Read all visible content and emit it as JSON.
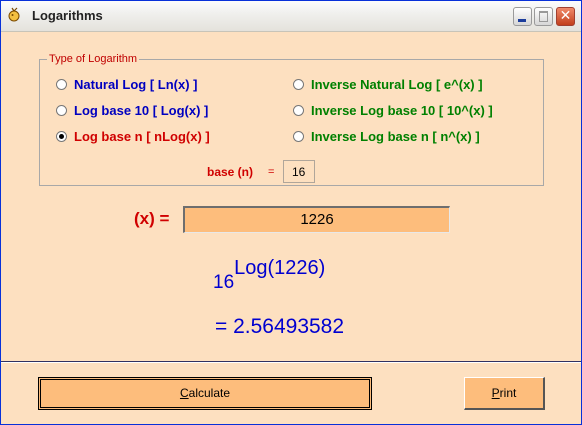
{
  "window": {
    "title": "Logarithms"
  },
  "group": {
    "title": "Type of Logarithm",
    "options": [
      {
        "label": "Natural Log  [ Ln(x) ]",
        "selected": false,
        "color": "#0000c0"
      },
      {
        "label": "Log base 10  [ Log(x) ]",
        "selected": false,
        "color": "#0000c0"
      },
      {
        "label": "Log base n  [ nLog(x) ]",
        "selected": true,
        "color": "#d00000"
      },
      {
        "label": "Inverse Natural Log  [ e^(x) ]",
        "selected": false,
        "color": "#008000"
      },
      {
        "label": "Inverse Log base 10  [ 10^(x) ]",
        "selected": false,
        "color": "#008000"
      },
      {
        "label": "Inverse Log base n  [ n^(x) ]",
        "selected": false,
        "color": "#008000"
      }
    ]
  },
  "base": {
    "label": "base (n)",
    "eq": "=",
    "value": "16"
  },
  "x": {
    "label": "(x) =",
    "value": "1226"
  },
  "formula": {
    "base": "16",
    "expr": "Log(1226)"
  },
  "result": {
    "text": "=  2.56493582"
  },
  "buttons": {
    "calculate": {
      "first": "C",
      "rest": "alculate"
    },
    "print": {
      "first": "P",
      "rest": "rint"
    }
  }
}
